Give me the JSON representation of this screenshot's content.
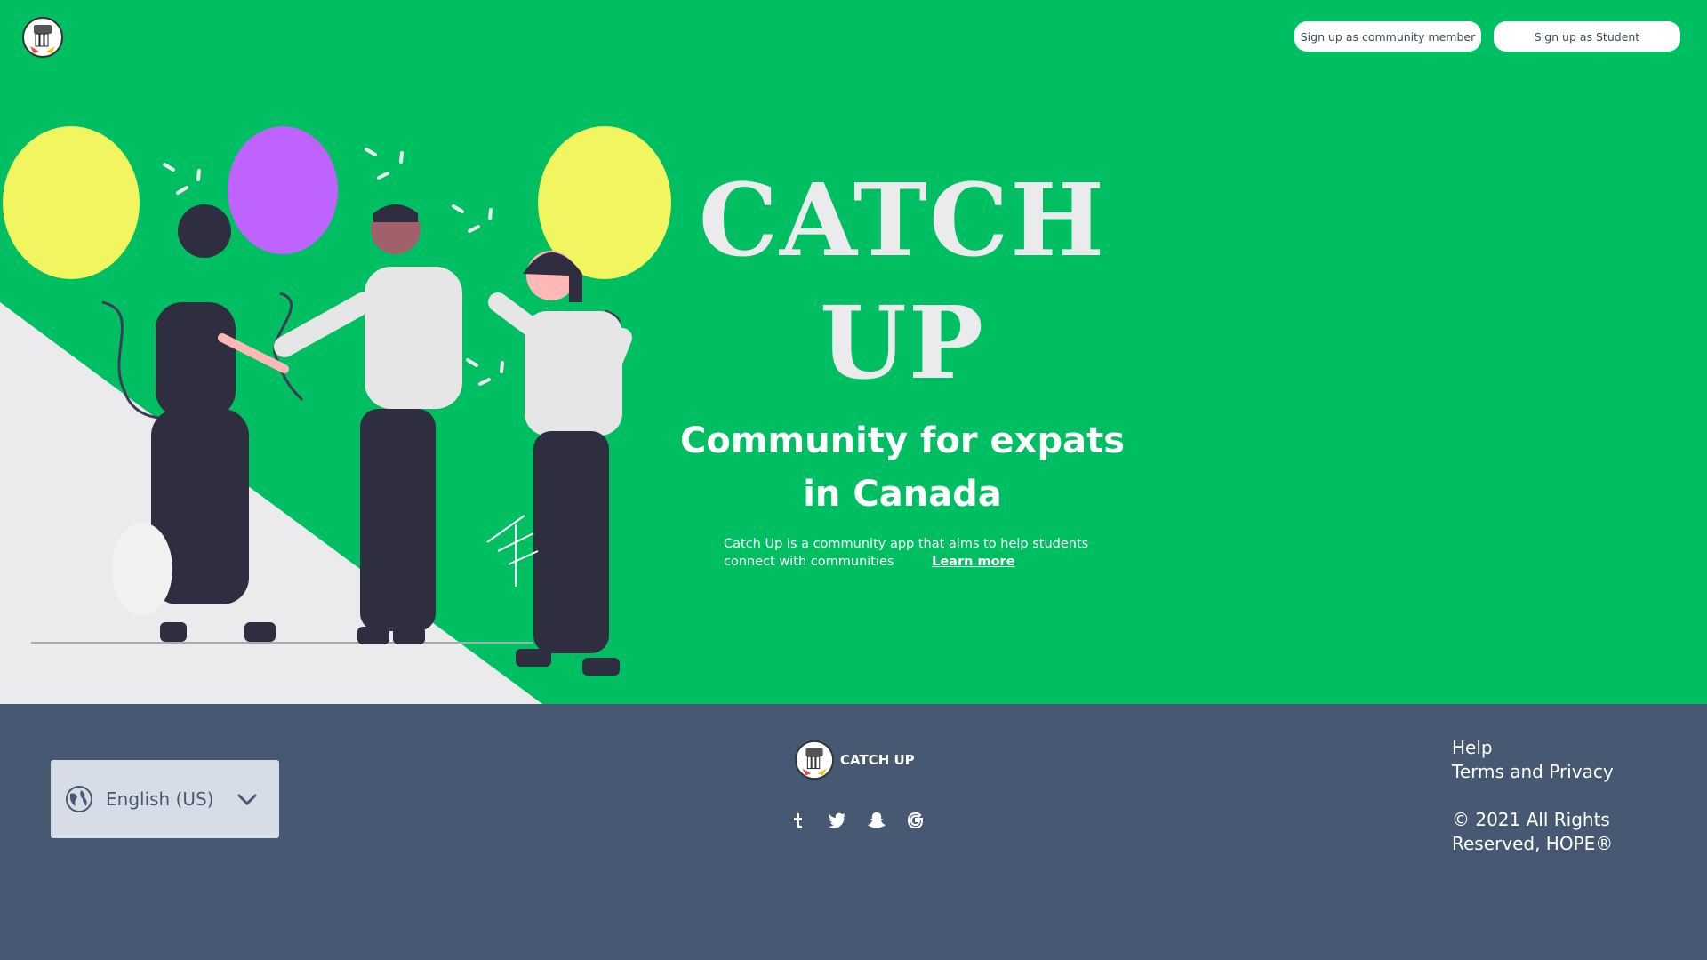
{
  "header": {
    "logo_icon": "catch-up-logo",
    "buttons": {
      "community": "Sign up as community member",
      "student": "Sign up as Student"
    }
  },
  "hero": {
    "title_line1": "CATCH",
    "title_line2": "UP",
    "subtitle_line1": "Community for expats",
    "subtitle_line2": "in Canada",
    "description_line1": "Catch Up is a community app that aims to help students",
    "description_line2": "connect with communities",
    "learn_more": "Learn more",
    "illustration": "people-with-balloons-illustration"
  },
  "footer": {
    "language": {
      "label": "English (US)",
      "icon": "globe-icon",
      "dropdown_icon": "chevron-down-icon"
    },
    "brand": "CATCH UP",
    "social_icons": [
      "tumblr-icon",
      "twitter-icon",
      "snapchat-icon",
      "google-icon"
    ],
    "links": {
      "help": "Help",
      "terms": "Terms and Privacy"
    },
    "copyright": "© 2021 All Rights Reserved, HOPE®"
  },
  "colors": {
    "brand_green": "#00BF63",
    "footer_bg": "#475872",
    "title_color": "#EBEBED"
  }
}
